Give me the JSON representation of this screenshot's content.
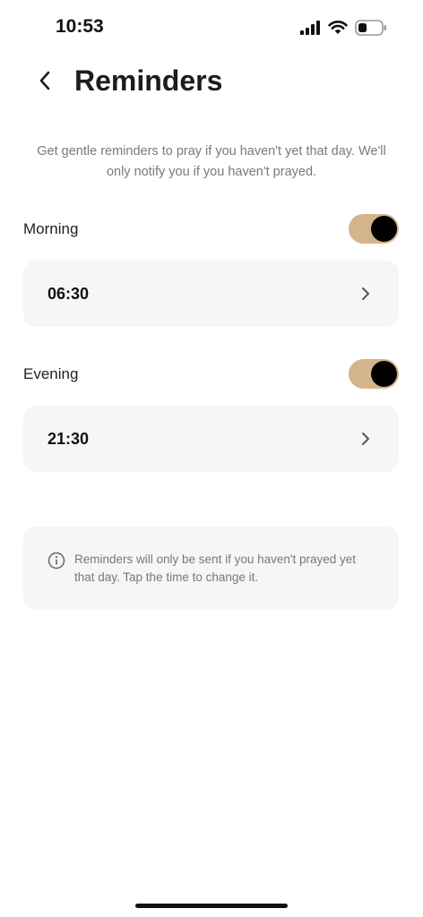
{
  "status_bar": {
    "time": "10:53"
  },
  "header": {
    "title": "Reminders"
  },
  "description": "Get gentle reminders to pray if you haven't yet that day. We'll only notify you if you haven't prayed.",
  "reminders": {
    "morning": {
      "label": "Morning",
      "enabled": true,
      "time": "06:30"
    },
    "evening": {
      "label": "Evening",
      "enabled": true,
      "time": "21:30"
    }
  },
  "info": {
    "text": "Reminders will only be sent if you haven't prayed yet that day. Tap the time to change it."
  },
  "colors": {
    "toggle_on": "#d4b48a",
    "card_background": "#f6f6f6",
    "secondary_text": "#7a7a7a"
  }
}
